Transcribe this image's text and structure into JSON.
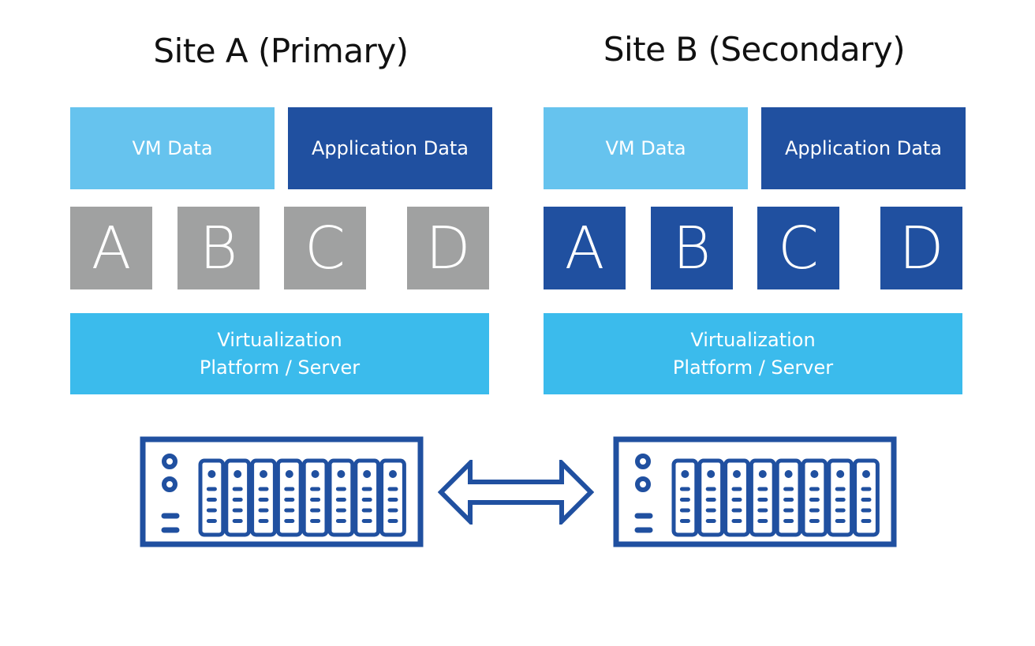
{
  "colors": {
    "vm_data": "#66c3ee",
    "application_data": "#2050a0",
    "vm_primary": "#a0a1a1",
    "vm_secondary": "#2050a0",
    "platform": "#3bbbec",
    "hardware_outline": "#2050a0"
  },
  "sites": [
    {
      "title": "Site A (Primary)",
      "vm_data_label": "VM Data",
      "app_data_label": "Application Data",
      "vms": [
        "A",
        "B",
        "C",
        "D"
      ],
      "vm_state": "inactive",
      "platform_line1": "Virtualization",
      "platform_line2": "Platform / Server",
      "storage_icon": "storage-array-icon"
    },
    {
      "title": "Site B (Secondary)",
      "vm_data_label": "VM Data",
      "app_data_label": "Application Data",
      "vms": [
        "A",
        "B",
        "C",
        "D"
      ],
      "vm_state": "active",
      "platform_line1": "Virtualization",
      "platform_line2": "Platform / Server",
      "storage_icon": "storage-array-icon"
    }
  ],
  "replication_icon": "bidirectional-arrow-icon",
  "storage_array": {
    "drive_bays": 8,
    "indicator_lights_per_bay": 4
  }
}
